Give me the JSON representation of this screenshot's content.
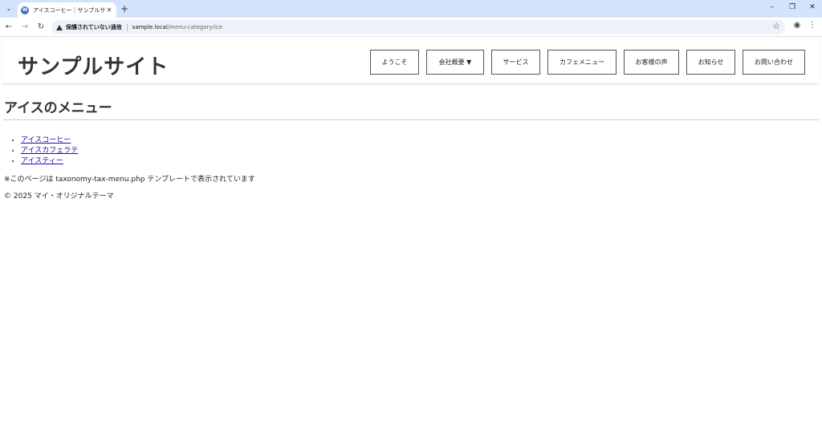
{
  "browser": {
    "tab_title": "アイスコーヒー｜サンプルサイト",
    "favicon": "W",
    "security_label": "保護されていない通信",
    "url_host": "sample.local",
    "url_path": "/menu-category/ice"
  },
  "site": {
    "title": "サンプルサイト",
    "nav": [
      {
        "label": "ようこそ"
      },
      {
        "label": "会社概要 ▼"
      },
      {
        "label": "サービス"
      },
      {
        "label": "カフェメニュー"
      },
      {
        "label": "お客様の声"
      },
      {
        "label": "お知らせ"
      },
      {
        "label": "お問い合わせ"
      }
    ]
  },
  "page": {
    "heading": "アイスのメニュー",
    "items": [
      "アイスコーヒー",
      "アイスカフェラテ",
      "アイスティー"
    ],
    "note": "※このページは taxonomy-tax-menu.php テンプレートで表示されています",
    "footer": "© 2025 マイ・オリジナルテーマ"
  }
}
